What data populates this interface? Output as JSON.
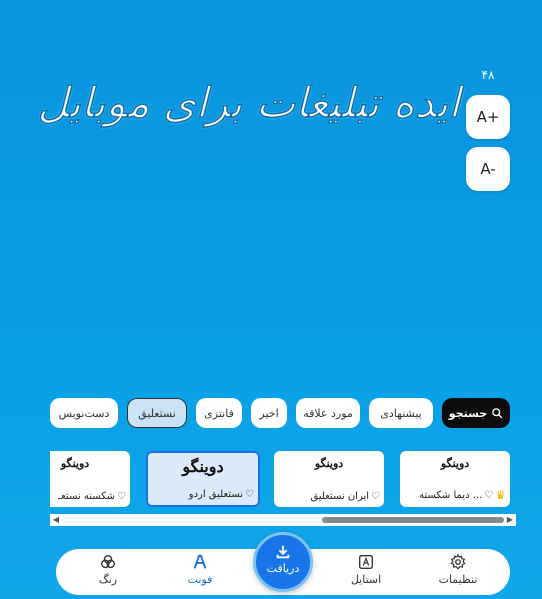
{
  "font_size": {
    "count": "۴۸",
    "increase_label": "A+",
    "decrease_label": "A-"
  },
  "preview": {
    "text": "ایده تبلیغات برای موبایل"
  },
  "categories": {
    "search_label": "جستجو",
    "items": [
      "پیشنهادی",
      "مورد علاقه",
      "اخیر",
      "فانتزی",
      "نستعلیق",
      "دست‌نویس"
    ],
    "active": "نستعلیق"
  },
  "fonts": [
    {
      "sample": "دوینگو",
      "name": "دیما شکسته ...",
      "premium": true
    },
    {
      "sample": "دوینگو",
      "name": "ایران نستعلیق",
      "premium": false
    },
    {
      "sample": "دوینگو",
      "name": "نستعلیق اردو",
      "premium": false,
      "selected": true
    },
    {
      "sample": "دوینگو",
      "name": "شکسته نستعـ",
      "premium": false
    }
  ],
  "nav": {
    "settings": "تنظیمات",
    "style": "استایل",
    "download": "دریافت",
    "font": "فونت",
    "color": "رنگ"
  },
  "icons": {
    "search": "search-icon",
    "heart": "heart-icon",
    "crown": "crown-icon",
    "settings": "gear-icon",
    "style": "style-icon",
    "download": "download-icon",
    "font": "font-icon",
    "color": "palette-icon"
  },
  "colors": {
    "background": "#0a9ae2",
    "accent": "#1976e8",
    "selected_card": "#dbe9f8",
    "active_chip": "#c9e2f4",
    "crown": "#f0b400"
  }
}
